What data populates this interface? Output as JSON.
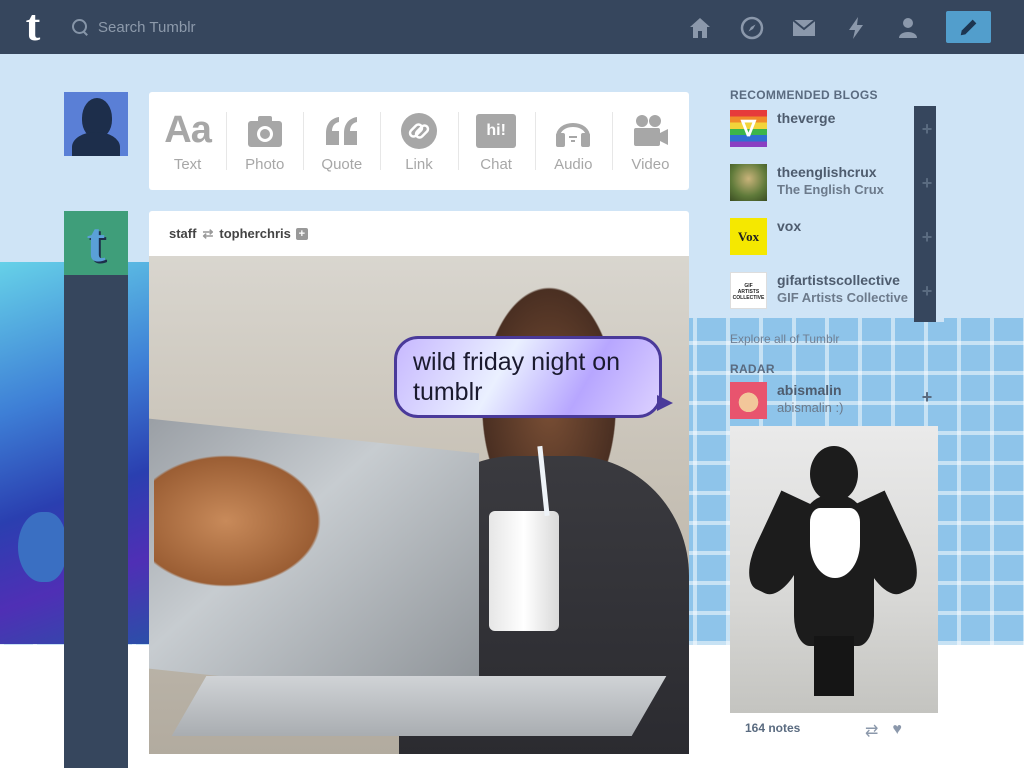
{
  "colors": {
    "topbar": "#36465d",
    "background": "#cfe4f6",
    "accent": "#529ecc",
    "post_card": "#ffffff"
  },
  "topbar": {
    "logo": "t",
    "search_placeholder": "Search Tumblr",
    "nav_icons": [
      "home-icon",
      "explore-compass-icon",
      "inbox-envelope-icon",
      "activity-lightning-icon",
      "account-person-icon"
    ],
    "compose_icon": "pencil-icon"
  },
  "post_types": [
    {
      "label": "Text",
      "icon": "text-aa-icon",
      "glyph": "Aa"
    },
    {
      "label": "Photo",
      "icon": "camera-icon"
    },
    {
      "label": "Quote",
      "icon": "quote-icon"
    },
    {
      "label": "Link",
      "icon": "link-icon"
    },
    {
      "label": "Chat",
      "icon": "chat-bubble-icon",
      "glyph": "hi!"
    },
    {
      "label": "Audio",
      "icon": "headphones-icon"
    },
    {
      "label": "Video",
      "icon": "video-camera-icon"
    }
  ],
  "post": {
    "author": "staff",
    "reblogged_from": "topherchris",
    "speech_bubble": "wild friday night on tumblr",
    "avatar_glyph": "t"
  },
  "sidebar": {
    "recommended_heading": "RECOMMENDED BLOGS",
    "recommended": [
      {
        "name": "theverge",
        "title": ""
      },
      {
        "name": "theenglishcrux",
        "title": "The English Crux"
      },
      {
        "name": "vox",
        "title": ""
      },
      {
        "name": "gifartistscollective",
        "title": "GIF Artists Collective"
      }
    ],
    "explore_link": "Explore all of Tumblr",
    "radar_heading": "RADAR",
    "radar": {
      "name": "abismalin",
      "title": "abismalin :)",
      "notes": "164 notes"
    }
  }
}
